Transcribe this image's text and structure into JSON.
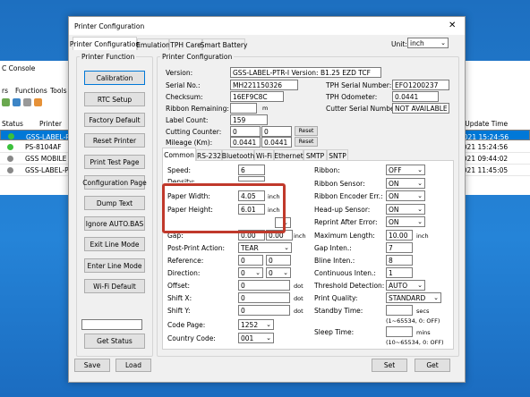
{
  "background": {
    "console_title": "C Console",
    "menu": [
      "rs",
      "Functions",
      "Tools"
    ],
    "col_status": "Status",
    "col_printer": "Printer",
    "col_update": "st Update Time",
    "rows": [
      {
        "name": "GSS-LABEL-P...",
        "time": "2021 15:24:56",
        "selected": true,
        "color": "#3cc03c"
      },
      {
        "name": "PS-8104AF",
        "time": "2021 15:24:56",
        "selected": false,
        "color": "#3cc03c"
      },
      {
        "name": "GSS MOBILE P...",
        "time": "2021 09:44:02",
        "selected": false,
        "color": "#888888"
      },
      {
        "name": "GSS-LABEL-P...",
        "time": "2021 11:45:05",
        "selected": false,
        "color": "#888888"
      }
    ]
  },
  "dialog": {
    "title": "Printer Configuration",
    "close": "✕",
    "tabs": [
      "Printer Configuration",
      "Emulation",
      "TPH Care",
      "Smart Battery"
    ],
    "unit_label": "Unit:",
    "unit_value": "inch"
  },
  "func": {
    "title": "Printer Function",
    "buttons": [
      "Calibration",
      "RTC Setup",
      "Factory Default",
      "Reset Printer",
      "Print Test Page",
      "Configuration Page",
      "Dump Text",
      "Ignore AUTO.BAS",
      "Exit Line Mode",
      "Enter Line Mode",
      "Wi-Fi Default"
    ],
    "status_value": "",
    "get_status": "Get Status"
  },
  "config": {
    "title": "Printer Configuration",
    "version_label": "Version:",
    "version": "GSS-LABEL-PTR-I Version: B1.25 EZD TCF",
    "serial_label": "Serial No.:",
    "serial": "MH221150326",
    "tph_serial_label": "TPH Serial Number:",
    "tph_serial": "EFO1200237",
    "checksum_label": "Checksum:",
    "checksum": "16EF9C8C",
    "tph_odo_label": "TPH Odometer:",
    "tph_odo": "0.0441",
    "ribbon_rem_label": "Ribbon Remaining:",
    "ribbon_rem": "",
    "ribbon_rem_unit": "m",
    "cutter_serial_label": "Cutter Serial Number:",
    "cutter_serial": "NOT AVAILABLE",
    "label_count_label": "Label Count:",
    "label_count": "159",
    "cutting_label": "Cutting Counter:",
    "cutting_a": "0",
    "cutting_b": "0",
    "reset1": "Reset",
    "mileage_label": "Mileage (Km):",
    "mileage_a": "0.0441",
    "mileage_b": "0.0441",
    "reset2": "Reset"
  },
  "subtabs": [
    "Common",
    "RS-232",
    "Bluetooth",
    "Wi-Fi",
    "Ethernet",
    "SMTP",
    "SNTP"
  ],
  "common": {
    "speed_label": "Speed:",
    "speed": "6",
    "density_label": "Density:",
    "density": "",
    "pw_label": "Paper Width:",
    "pw": "4.05",
    "pw_unit": "inch",
    "ph_label": "Paper Height:",
    "ph": "6.01",
    "ph_unit": "inch",
    "media_value": "",
    "gap_label": "Gap:",
    "gap_a": "0.00",
    "gap_b": "0.00",
    "gap_unit": "inch",
    "ppa_label": "Post-Print Action:",
    "ppa": "TEAR",
    "ref_label": "Reference:",
    "ref_a": "0",
    "ref_b": "0",
    "dir_label": "Direction:",
    "dir_a": "0",
    "dir_b": "0",
    "offset_label": "Offset:",
    "offset": "0",
    "offset_unit": "dot",
    "shiftx_label": "Shift X:",
    "shiftx": "0",
    "shiftx_unit": "dot",
    "shifty_label": "Shift Y:",
    "shifty": "0",
    "shifty_unit": "dot",
    "codepage_label": "Code Page:",
    "codepage": "1252",
    "country_label": "Country Code:",
    "country": "001",
    "ribbon_label": "Ribbon:",
    "ribbon": "OFF",
    "ribbon_sensor_label": "Ribbon Sensor:",
    "ribbon_sensor": "ON",
    "ribbon_enc_label": "Ribbon Encoder Err.:",
    "ribbon_enc": "ON",
    "headup_label": "Head-up Sensor:",
    "headup": "ON",
    "reprint_label": "Reprint After Error:",
    "reprint": "ON",
    "maxlen_label": "Maximum Length:",
    "maxlen": "10.00",
    "maxlen_unit": "inch",
    "gapint_label": "Gap Inten.:",
    "gapint": "7",
    "bline_label": "Bline Inten.:",
    "bline": "8",
    "cont_label": "Continuous Inten.:",
    "cont": "1",
    "thresh_label": "Threshold Detection:",
    "thresh": "AUTO",
    "pq_label": "Print Quality:",
    "pq": "STANDARD",
    "standby_label": "Standby Time:",
    "standby": "",
    "standby_unit": "secs",
    "standby_range": "(1~65534, 0: OFF)",
    "sleep_label": "Sleep Time:",
    "sleep": "",
    "sleep_unit": "mins",
    "sleep_range": "(10~65534, 0: OFF)"
  },
  "bottom": {
    "save": "Save",
    "load": "Load",
    "set": "Set",
    "get": "Get"
  },
  "colors": {
    "accent": "#0078d7",
    "highlight": "#c0392b"
  }
}
